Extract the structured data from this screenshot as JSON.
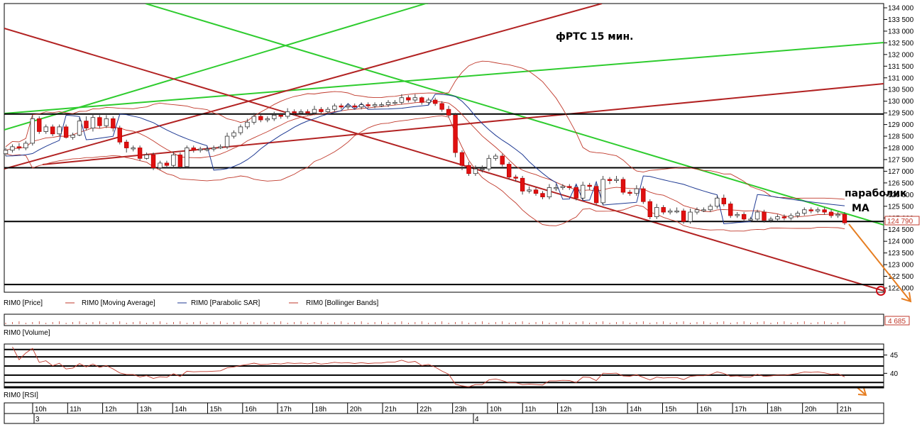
{
  "chart_data": {
    "type": "candlestick",
    "title": "фРТС   15 мин.",
    "annotation": [
      "параболик",
      "МА"
    ],
    "price_axis": {
      "ticks": [
        "134 000",
        "133 500",
        "133 000",
        "132 500",
        "132 000",
        "131 500",
        "131 000",
        "130 500",
        "130 000",
        "129 500",
        "129 000",
        "128 500",
        "128 000",
        "127 500",
        "127 000",
        "126 500",
        "126 000",
        "125 500",
        "125 000",
        "124 500",
        "124 000",
        "123 500",
        "123 000",
        "122 500",
        "122 000"
      ],
      "ylim": [
        122000,
        134000
      ],
      "last_price_label": "124 790",
      "last_price": 124790
    },
    "horizontal_levels": [
      129450,
      127150,
      124850,
      122150
    ],
    "legend": [
      {
        "label": "RIM0 [Price]",
        "color": "#000000"
      },
      {
        "label": "RIM0 [Moving Average]",
        "color": "#c0392b"
      },
      {
        "label": "RIM0 [Parabolic SAR]",
        "color": "#1f3a93"
      },
      {
        "label": "RIM0 [Bollinger Bands]",
        "color": "#c0392b"
      }
    ],
    "candles": [
      {
        "o": 127750,
        "c": 127900,
        "h": 128000,
        "l": 127650
      },
      {
        "o": 127900,
        "c": 128050,
        "h": 128150,
        "l": 127800
      },
      {
        "o": 128050,
        "c": 128000,
        "h": 128200,
        "l": 127900
      },
      {
        "o": 128000,
        "c": 128200,
        "h": 128300,
        "l": 127900
      },
      {
        "o": 128200,
        "c": 129250,
        "h": 129400,
        "l": 128100
      },
      {
        "o": 129250,
        "c": 128700,
        "h": 129350,
        "l": 128600
      },
      {
        "o": 128700,
        "c": 128900,
        "h": 129000,
        "l": 128600
      },
      {
        "o": 128900,
        "c": 128600,
        "h": 129000,
        "l": 128500
      },
      {
        "o": 128600,
        "c": 128900,
        "h": 129000,
        "l": 128500
      },
      {
        "o": 128900,
        "c": 128450,
        "h": 129000,
        "l": 128400
      },
      {
        "o": 128450,
        "c": 128550,
        "h": 128650,
        "l": 128350
      },
      {
        "o": 128550,
        "c": 129150,
        "h": 129300,
        "l": 128500
      },
      {
        "o": 129150,
        "c": 128850,
        "h": 129350,
        "l": 128750
      },
      {
        "o": 128850,
        "c": 129300,
        "h": 129450,
        "l": 128700
      },
      {
        "o": 129300,
        "c": 128950,
        "h": 129400,
        "l": 128850
      },
      {
        "o": 128950,
        "c": 129250,
        "h": 129400,
        "l": 128850
      },
      {
        "o": 129250,
        "c": 128850,
        "h": 129350,
        "l": 128700
      },
      {
        "o": 128850,
        "c": 128250,
        "h": 128950,
        "l": 128150
      },
      {
        "o": 128250,
        "c": 128000,
        "h": 128350,
        "l": 127800
      },
      {
        "o": 128000,
        "c": 128000,
        "h": 128100,
        "l": 127850
      },
      {
        "o": 128000,
        "c": 127550,
        "h": 128100,
        "l": 127450
      },
      {
        "o": 127550,
        "c": 127700,
        "h": 127800,
        "l": 127500
      },
      {
        "o": 127700,
        "c": 127150,
        "h": 127800,
        "l": 127050
      },
      {
        "o": 127150,
        "c": 127350,
        "h": 127450,
        "l": 127050
      },
      {
        "o": 127350,
        "c": 127250,
        "h": 127450,
        "l": 127150
      },
      {
        "o": 127250,
        "c": 127700,
        "h": 127850,
        "l": 127150
      },
      {
        "o": 127700,
        "c": 127200,
        "h": 127800,
        "l": 127100
      },
      {
        "o": 127200,
        "c": 128000,
        "h": 128100,
        "l": 127150
      },
      {
        "o": 128000,
        "c": 127900,
        "h": 128100,
        "l": 127800
      },
      {
        "o": 127900,
        "c": 127950,
        "h": 128050,
        "l": 127800
      },
      {
        "o": 127950,
        "c": 127950,
        "h": 128050,
        "l": 127850
      },
      {
        "o": 127950,
        "c": 128000,
        "h": 128100,
        "l": 127850
      },
      {
        "o": 128000,
        "c": 128050,
        "h": 128150,
        "l": 127950
      },
      {
        "o": 128050,
        "c": 128500,
        "h": 128650,
        "l": 127950
      },
      {
        "o": 128500,
        "c": 128650,
        "h": 128750,
        "l": 128400
      },
      {
        "o": 128650,
        "c": 128900,
        "h": 129000,
        "l": 128550
      },
      {
        "o": 128900,
        "c": 129100,
        "h": 129250,
        "l": 128800
      },
      {
        "o": 129100,
        "c": 129350,
        "h": 129500,
        "l": 129000
      },
      {
        "o": 129350,
        "c": 129200,
        "h": 129450,
        "l": 129100
      },
      {
        "o": 129200,
        "c": 129250,
        "h": 129350,
        "l": 129100
      },
      {
        "o": 129250,
        "c": 129400,
        "h": 129550,
        "l": 129150
      },
      {
        "o": 129400,
        "c": 129350,
        "h": 129500,
        "l": 129250
      },
      {
        "o": 129350,
        "c": 129550,
        "h": 129700,
        "l": 129250
      },
      {
        "o": 129550,
        "c": 129500,
        "h": 129650,
        "l": 129400
      },
      {
        "o": 129500,
        "c": 129550,
        "h": 129650,
        "l": 129400
      },
      {
        "o": 129550,
        "c": 129500,
        "h": 129650,
        "l": 129400
      },
      {
        "o": 129500,
        "c": 129650,
        "h": 129800,
        "l": 129400
      },
      {
        "o": 129650,
        "c": 129550,
        "h": 129750,
        "l": 129450
      },
      {
        "o": 129550,
        "c": 129650,
        "h": 129750,
        "l": 129450
      },
      {
        "o": 129650,
        "c": 129800,
        "h": 129900,
        "l": 129550
      },
      {
        "o": 129800,
        "c": 129750,
        "h": 129900,
        "l": 129650
      },
      {
        "o": 129750,
        "c": 129800,
        "h": 129900,
        "l": 129650
      },
      {
        "o": 129800,
        "c": 129750,
        "h": 129900,
        "l": 129650
      },
      {
        "o": 129750,
        "c": 129850,
        "h": 129950,
        "l": 129650
      },
      {
        "o": 129850,
        "c": 129800,
        "h": 129950,
        "l": 129700
      },
      {
        "o": 129800,
        "c": 129850,
        "h": 129950,
        "l": 129700
      },
      {
        "o": 129850,
        "c": 129850,
        "h": 129950,
        "l": 129750
      },
      {
        "o": 129850,
        "c": 129950,
        "h": 130050,
        "l": 129750
      },
      {
        "o": 129950,
        "c": 129950,
        "h": 130050,
        "l": 129850
      },
      {
        "o": 129950,
        "c": 130150,
        "h": 130300,
        "l": 129850
      },
      {
        "o": 130150,
        "c": 130050,
        "h": 130250,
        "l": 129950
      },
      {
        "o": 130050,
        "c": 130150,
        "h": 130300,
        "l": 129950
      },
      {
        "o": 130150,
        "c": 129950,
        "h": 130200,
        "l": 129850
      },
      {
        "o": 129950,
        "c": 130050,
        "h": 130150,
        "l": 129850
      },
      {
        "o": 130050,
        "c": 129900,
        "h": 130150,
        "l": 129800
      },
      {
        "o": 129900,
        "c": 129650,
        "h": 130000,
        "l": 129550
      },
      {
        "o": 129650,
        "c": 129400,
        "h": 129800,
        "l": 129300
      },
      {
        "o": 129400,
        "c": 127800,
        "h": 129500,
        "l": 127600
      },
      {
        "o": 127800,
        "c": 127250,
        "h": 127900,
        "l": 127050
      },
      {
        "o": 127250,
        "c": 126900,
        "h": 127400,
        "l": 126800
      },
      {
        "o": 126900,
        "c": 127100,
        "h": 127250,
        "l": 126800
      },
      {
        "o": 127100,
        "c": 127100,
        "h": 127250,
        "l": 126950
      },
      {
        "o": 127100,
        "c": 127550,
        "h": 127700,
        "l": 127000
      },
      {
        "o": 127550,
        "c": 127650,
        "h": 127750,
        "l": 127450
      },
      {
        "o": 127650,
        "c": 127300,
        "h": 127750,
        "l": 127200
      },
      {
        "o": 127300,
        "c": 126750,
        "h": 127400,
        "l": 126650
      },
      {
        "o": 126750,
        "c": 126700,
        "h": 126850,
        "l": 126550
      },
      {
        "o": 126700,
        "c": 126150,
        "h": 126800,
        "l": 126000
      },
      {
        "o": 126150,
        "c": 126200,
        "h": 126350,
        "l": 126050
      },
      {
        "o": 126200,
        "c": 126050,
        "h": 126300,
        "l": 125950
      },
      {
        "o": 126050,
        "c": 125900,
        "h": 126150,
        "l": 125800
      },
      {
        "o": 125900,
        "c": 126300,
        "h": 126450,
        "l": 125800
      },
      {
        "o": 126300,
        "c": 126300,
        "h": 126450,
        "l": 126150
      },
      {
        "o": 126300,
        "c": 126350,
        "h": 126450,
        "l": 126200
      },
      {
        "o": 126350,
        "c": 126300,
        "h": 126450,
        "l": 126200
      },
      {
        "o": 126300,
        "c": 125850,
        "h": 126400,
        "l": 125750
      },
      {
        "o": 125850,
        "c": 126400,
        "h": 126550,
        "l": 125750
      },
      {
        "o": 126400,
        "c": 126350,
        "h": 126500,
        "l": 126200
      },
      {
        "o": 126350,
        "c": 125650,
        "h": 126450,
        "l": 125550
      },
      {
        "o": 125650,
        "c": 126650,
        "h": 126800,
        "l": 125550
      },
      {
        "o": 126650,
        "c": 126600,
        "h": 126750,
        "l": 126450
      },
      {
        "o": 126600,
        "c": 126650,
        "h": 126800,
        "l": 126500
      },
      {
        "o": 126650,
        "c": 126100,
        "h": 126750,
        "l": 126000
      },
      {
        "o": 126100,
        "c": 126050,
        "h": 126200,
        "l": 125950
      },
      {
        "o": 126050,
        "c": 126250,
        "h": 126400,
        "l": 125950
      },
      {
        "o": 126250,
        "c": 125700,
        "h": 126350,
        "l": 125600
      },
      {
        "o": 125700,
        "c": 125050,
        "h": 125800,
        "l": 124950
      },
      {
        "o": 125050,
        "c": 125450,
        "h": 125600,
        "l": 124950
      },
      {
        "o": 125450,
        "c": 125250,
        "h": 125550,
        "l": 125150
      },
      {
        "o": 125250,
        "c": 125300,
        "h": 125400,
        "l": 125150
      },
      {
        "o": 125300,
        "c": 125300,
        "h": 125450,
        "l": 125200
      },
      {
        "o": 125300,
        "c": 124850,
        "h": 125400,
        "l": 124750
      },
      {
        "o": 124850,
        "c": 125250,
        "h": 125400,
        "l": 124750
      },
      {
        "o": 125250,
        "c": 125350,
        "h": 125450,
        "l": 125150
      },
      {
        "o": 125350,
        "c": 125350,
        "h": 125450,
        "l": 125250
      },
      {
        "o": 125350,
        "c": 125500,
        "h": 125600,
        "l": 125250
      },
      {
        "o": 125500,
        "c": 125850,
        "h": 125950,
        "l": 125400
      },
      {
        "o": 125850,
        "c": 125600,
        "h": 126000,
        "l": 125500
      },
      {
        "o": 125600,
        "c": 125100,
        "h": 125700,
        "l": 125000
      },
      {
        "o": 125100,
        "c": 125150,
        "h": 125250,
        "l": 125000
      },
      {
        "o": 125150,
        "c": 124950,
        "h": 125250,
        "l": 124850
      },
      {
        "o": 124950,
        "c": 124950,
        "h": 125050,
        "l": 124850
      },
      {
        "o": 124950,
        "c": 125250,
        "h": 125350,
        "l": 124850
      },
      {
        "o": 125250,
        "c": 124900,
        "h": 125350,
        "l": 124800
      },
      {
        "o": 124900,
        "c": 124950,
        "h": 125050,
        "l": 124800
      },
      {
        "o": 124950,
        "c": 125050,
        "h": 125150,
        "l": 124850
      },
      {
        "o": 125050,
        "c": 125000,
        "h": 125150,
        "l": 124900
      },
      {
        "o": 125000,
        "c": 125100,
        "h": 125200,
        "l": 124900
      },
      {
        "o": 125100,
        "c": 125200,
        "h": 125300,
        "l": 125000
      },
      {
        "o": 125200,
        "c": 125350,
        "h": 125450,
        "l": 125100
      },
      {
        "o": 125350,
        "c": 125300,
        "h": 125450,
        "l": 125200
      },
      {
        "o": 125300,
        "c": 125350,
        "h": 125450,
        "l": 125200
      },
      {
        "o": 125350,
        "c": 125250,
        "h": 125450,
        "l": 125150
      },
      {
        "o": 125250,
        "c": 125100,
        "h": 125350,
        "l": 125000
      },
      {
        "o": 125100,
        "c": 125150,
        "h": 125250,
        "l": 125000
      },
      {
        "o": 125150,
        "c": 124790,
        "h": 125250,
        "l": 124700
      }
    ],
    "volume_label": "RIM0 [Volume]",
    "volume_last": "4 685",
    "rsi": {
      "label": "RIM0 [RSI]",
      "ticks": [
        "45",
        "40"
      ],
      "tick_values": [
        45,
        40
      ],
      "ylim": [
        36,
        48
      ],
      "levels": [
        46.5,
        44.5,
        42,
        39.5,
        37.5,
        36.3
      ]
    },
    "time_labels": [
      "10h",
      "11h",
      "12h",
      "13h",
      "14h",
      "15h",
      "16h",
      "17h",
      "18h",
      "20h",
      "21h",
      "22h",
      "23h",
      "10h",
      "11h",
      "12h",
      "13h",
      "14h",
      "15h",
      "16h",
      "17h",
      "18h",
      "20h",
      "21h"
    ],
    "date_labels": [
      "3",
      "4"
    ]
  }
}
